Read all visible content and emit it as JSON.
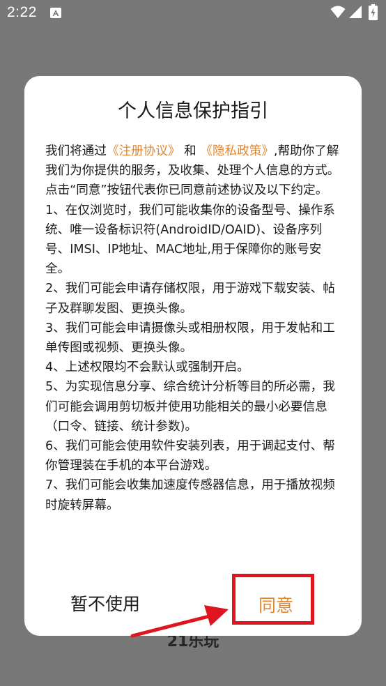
{
  "status_bar": {
    "time": "2:22",
    "icons": [
      "a-notification-icon",
      "wifi-icon",
      "signal-icon",
      "battery-charging-icon"
    ]
  },
  "background": {
    "app_name_partial": "21乐玩"
  },
  "dialog": {
    "title": "个人信息保护指引",
    "intro_prefix": "我们将通过",
    "link_register": "《注册协议》",
    "intro_and": " 和 ",
    "link_privacy": "《隐私政策》",
    "intro_suffix": ",帮助你了解我们为你提供的服务，及收集、处理个人信息的方式。",
    "consent_note": "点击“同意”按钮代表你已同意前述协议及以下约定。",
    "items": [
      "1、在仅浏览时，我们可能收集你的设备型号、操作系统、唯一设备标识符(AndroidID/OAID)、设备序列号、IMSI、IP地址、MAC地址,用于保障你的账号安全。",
      "2、我们可能会申请存储权限，用于游戏下载安装、帖子及群聊发图、更换头像。",
      "3、我们可能会申请摄像头或相册权限，用于发帖和工单传图或视频、更换头像。",
      "4、上述权限均不会默认或强制开启。",
      "5、为实现信息分享、综合统计分析等目的所必需，我们可能会调用剪切板并使用功能相关的最小必要信息（口令、链接、统计参数)。",
      "6、我们可能会使用软件安装列表，用于调起支付、帮你管理装在手机的本平台游戏。",
      "7、我们可能会收集加速度传感器信息，用于播放视频时旋转屏幕。"
    ],
    "decline_label": "暂不使用",
    "agree_label": "同意"
  },
  "colors": {
    "overlay": "#787878",
    "link_accent": "#e2872f",
    "annotation_red": "#e0141e"
  }
}
